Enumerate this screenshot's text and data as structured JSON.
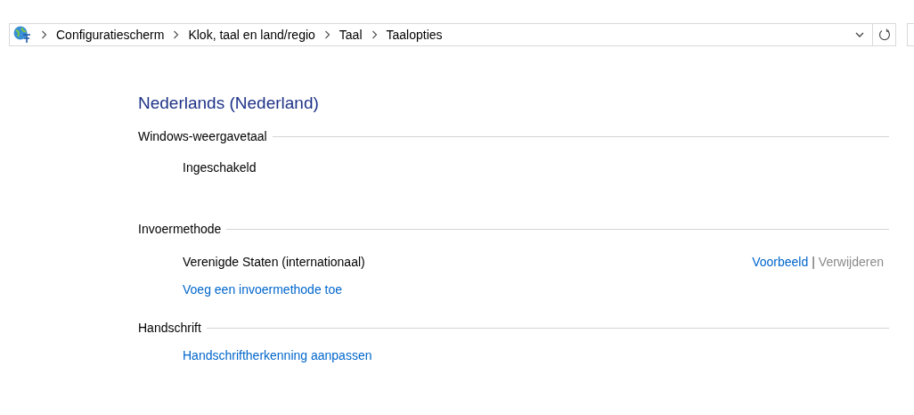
{
  "breadcrumb": [
    "Configuratiescherm",
    "Klok, taal en land/regio",
    "Taal",
    "Taalopties"
  ],
  "title": "Nederlands (Nederland)",
  "sections": [
    {
      "heading": "Windows-weergavetaal",
      "items": [
        {
          "kind": "status",
          "text": "Ingeschakeld"
        }
      ]
    },
    {
      "heading": "Invoermethode",
      "items": [
        {
          "kind": "method",
          "text": "Verenigde Staten (internationaal)",
          "actions": [
            {
              "label": "Voorbeeld",
              "disabled": false
            },
            {
              "label": "Verwijderen",
              "disabled": true
            }
          ],
          "separator": "|"
        },
        {
          "kind": "link",
          "text": "Voeg een invoermethode toe"
        }
      ]
    },
    {
      "heading": "Handschrift",
      "items": [
        {
          "kind": "link",
          "text": "Handschriftherkenning aanpassen"
        }
      ]
    }
  ]
}
